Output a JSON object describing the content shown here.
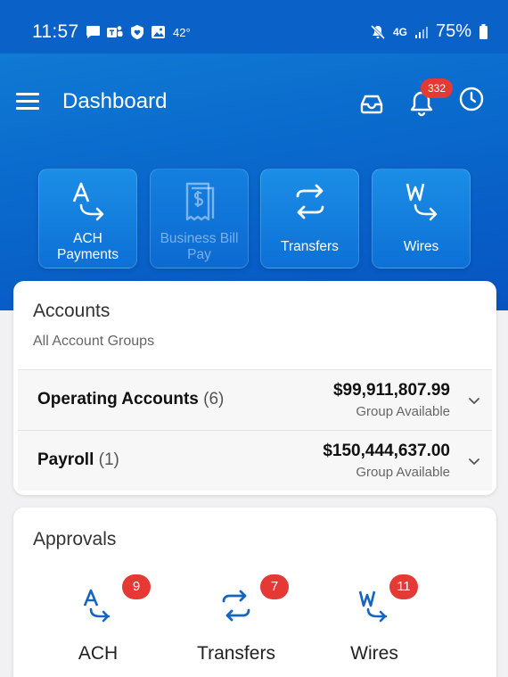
{
  "status_bar": {
    "time": "11:57",
    "temperature": "42°",
    "network": "4G",
    "battery": "75%",
    "left_icons": [
      "chat-icon",
      "teams-icon",
      "shield-heart-icon",
      "image-icon"
    ],
    "right_icons": [
      "mute-icon",
      "network-4g-icon",
      "signal-icon",
      "battery-icon"
    ]
  },
  "app_bar": {
    "title": "Dashboard",
    "notification_count": "332"
  },
  "quick_actions": [
    {
      "label_line1": "ACH",
      "label_line2": "Payments",
      "icon": "ach-icon",
      "enabled": true
    },
    {
      "label_line1": "Business Bill",
      "label_line2": "Pay",
      "icon": "bill-pay-icon",
      "enabled": false
    },
    {
      "label_line1": "Transfers",
      "label_line2": "",
      "icon": "transfer-icon",
      "enabled": true
    },
    {
      "label_line1": "Wires",
      "label_line2": "",
      "icon": "wire-icon",
      "enabled": true
    }
  ],
  "accounts": {
    "title": "Accounts",
    "subtitle": "All Account Groups",
    "groups": [
      {
        "name": "Operating Accounts",
        "count": "(6)",
        "amount": "$99,911,807.99",
        "amount_label": "Group Available"
      },
      {
        "name": "Payroll",
        "count": "(1)",
        "amount": "$150,444,637.00",
        "amount_label": "Group Available"
      }
    ]
  },
  "approvals": {
    "title": "Approvals",
    "items": [
      {
        "label": "ACH",
        "count": "9",
        "icon": "ach-icon"
      },
      {
        "label": "Transfers",
        "count": "7",
        "icon": "transfer-icon"
      },
      {
        "label": "Wires",
        "count": "11",
        "icon": "wire-icon"
      }
    ]
  },
  "colors": {
    "header_blue": "#0a6bcd",
    "badge_red": "#e53935",
    "approval_icon_blue": "#1565c0"
  }
}
